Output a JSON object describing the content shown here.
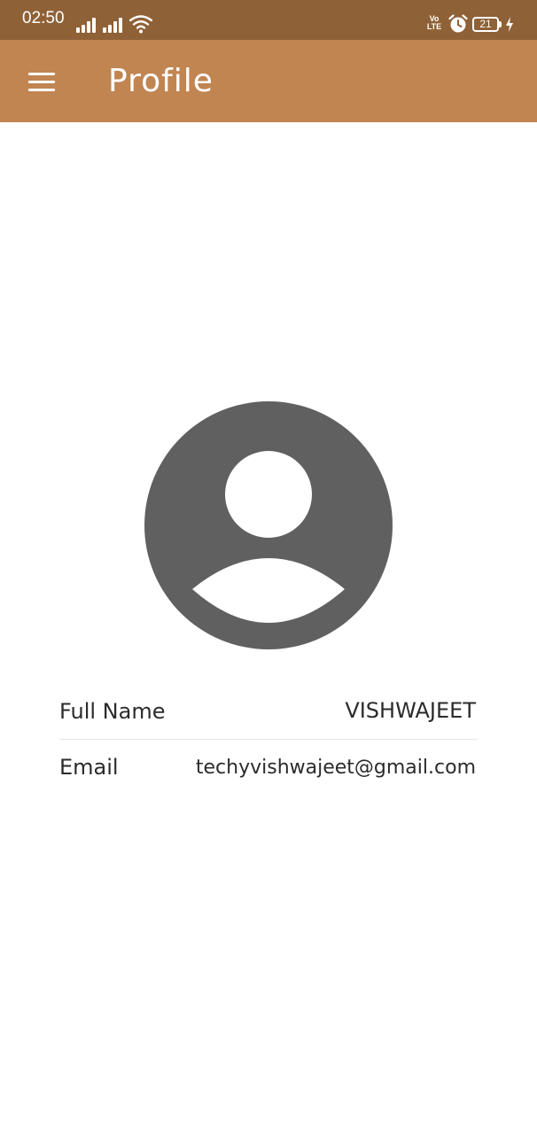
{
  "status_bar": {
    "time": "02:50",
    "volte_line1": "Vo",
    "volte_line2": "LTE",
    "battery_level": "21",
    "icons": [
      "signal-icon",
      "signal-icon",
      "wifi-icon",
      "volte-icon",
      "alarm-icon",
      "battery-icon",
      "charging-icon"
    ],
    "color": "#8f6136"
  },
  "app_bar": {
    "title": "Profile",
    "menu_icon": "hamburger-menu-icon",
    "color": "#c18552"
  },
  "avatar": {
    "icon": "account-circle-icon",
    "color": "#606060"
  },
  "profile": {
    "name_label": "Full Name",
    "name_value": "VISHWAJEET",
    "email_label": "Email",
    "email_value": "techyvishwajeet@gmail.com"
  }
}
